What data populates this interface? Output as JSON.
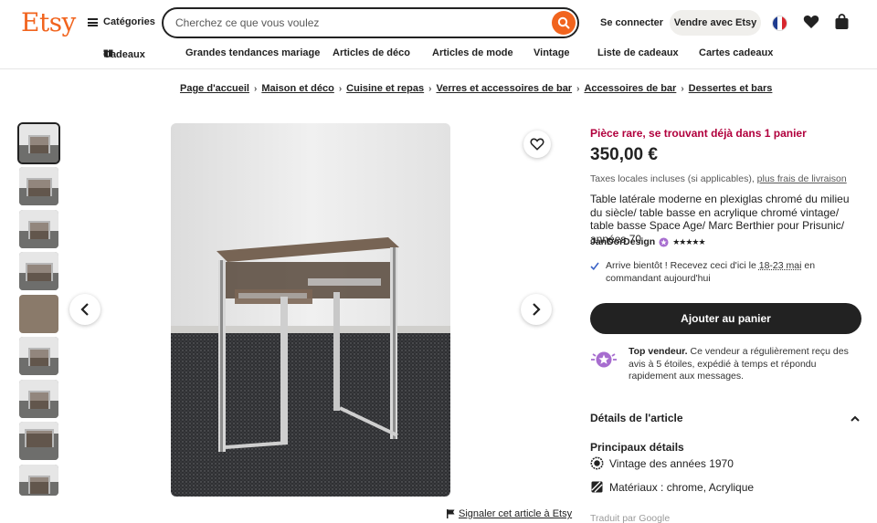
{
  "header": {
    "logo": "Etsy",
    "categories_label": "Catégories",
    "search_placeholder": "Cherchez ce que vous voulez",
    "signin_label": "Se connecter",
    "sell_label": "Vendre avec Etsy"
  },
  "subnav": {
    "items": [
      "Cadeaux",
      "Grandes tendances mariage",
      "Articles de déco",
      "Articles de mode",
      "Vintage",
      "Liste de cadeaux",
      "Cartes cadeaux"
    ]
  },
  "breadcrumb": [
    "Page d'accueil",
    "Maison et déco",
    "Cuisine et repas",
    "Verres et accessoires de bar",
    "Accessoires de bar",
    "Dessertes et bars"
  ],
  "gallery": {
    "thumbnail_count": 9,
    "selected_index": 0,
    "report_label": "Signaler cet article à Etsy"
  },
  "product": {
    "rare_label": "Pièce rare, se trouvant déjà dans 1 panier",
    "price": "350,00 €",
    "taxes_text": "Taxes locales incluses (si applicables), ",
    "shipping_link": "plus frais de livraison",
    "title": "Table latérale moderne en plexiglas chromé du milieu du siècle/ table basse en acrylique chromé vintage/ table basse Space Age/ Marc Berthier pour Prisunic/ années 70",
    "shop_name": "JanDorDesign",
    "rating_stars": 5,
    "arrive_before": "Arrive bientôt ! Recevez ceci d'ici le ",
    "arrive_dates": "18-23 mai",
    "arrive_after": " en commandant aujourd'hui",
    "cart_label": "Ajouter au panier",
    "top_seller_title": "Top vendeur.",
    "top_seller_text": " Ce vendeur a régulièrement reçu des avis à 5 étoiles, expédié à temps et répondu rapidement aux messages.",
    "details_label": "Détails de l'article",
    "main_details_label": "Principaux détails",
    "details": [
      "Vintage des années 1970",
      "Matériaux : chrome, Acrylique"
    ],
    "translated_label": "Traduit par Google"
  },
  "colors": {
    "brand": "#f1641e",
    "rare": "#b1003d",
    "dark": "#222222"
  }
}
